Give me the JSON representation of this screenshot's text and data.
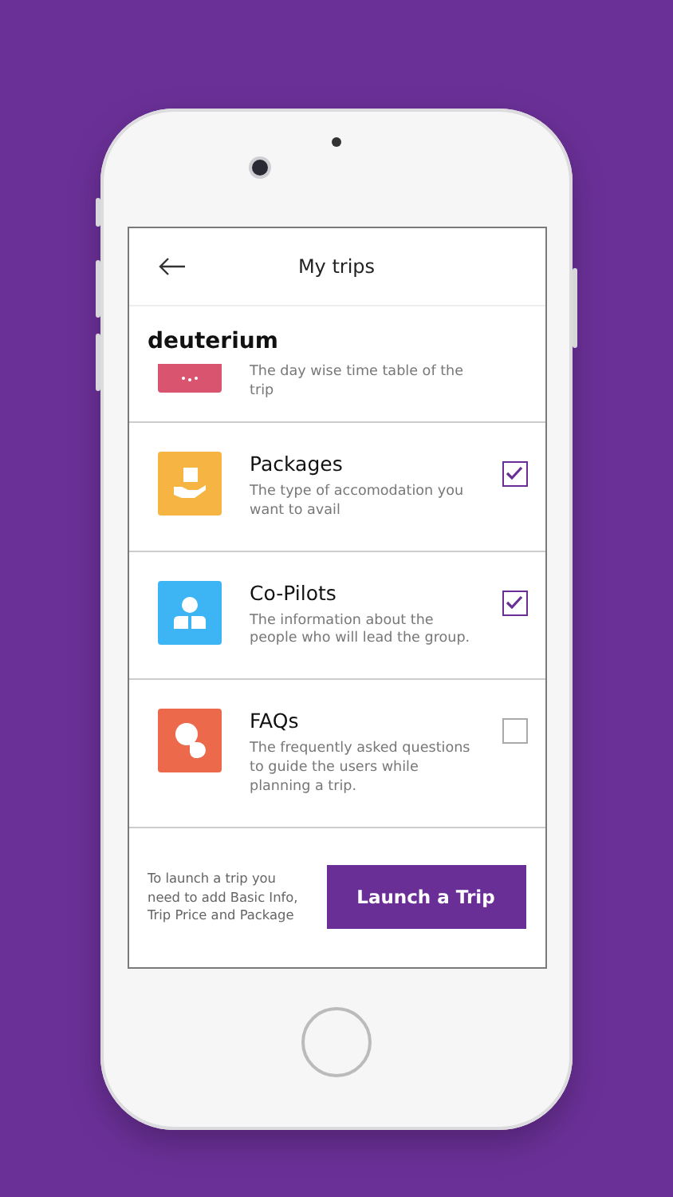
{
  "header": {
    "title": "My trips"
  },
  "trip_name": "deuterium",
  "items": [
    {
      "kind": "partial",
      "color": "#d9556f",
      "description": "The day wise time table of the trip"
    },
    {
      "kind": "option",
      "color": "#f6b443",
      "title": "Packages",
      "description": "The type of accomodation you want to avail",
      "checked": true
    },
    {
      "kind": "option",
      "color": "#3db5f5",
      "title": "Co-Pilots",
      "description": "The information about the people who will lead the group.",
      "checked": true
    },
    {
      "kind": "option",
      "color": "#ec6a4b",
      "title": "FAQs",
      "description": "The frequently asked questions to guide the users while planning a trip.",
      "checked": false
    }
  ],
  "footer": {
    "note": "To launch a  trip you need to add Basic Info, Trip Price and Package",
    "button": "Launch a Trip"
  }
}
